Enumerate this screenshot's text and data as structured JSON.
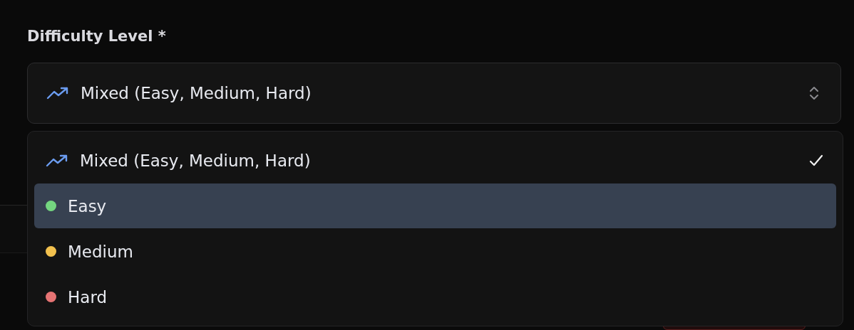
{
  "field": {
    "label": "Difficulty Level *",
    "value": "Mixed (Easy, Medium, Hard)"
  },
  "options": [
    {
      "label": "Mixed (Easy, Medium, Hard)",
      "kind": "trend",
      "selected": true,
      "highlighted": false
    },
    {
      "label": "Easy",
      "kind": "dot",
      "color": "#74d680",
      "selected": false,
      "highlighted": true
    },
    {
      "label": "Medium",
      "kind": "dot",
      "color": "#f2c14e",
      "selected": false,
      "highlighted": false
    },
    {
      "label": "Hard",
      "kind": "dot",
      "color": "#e57373",
      "selected": false,
      "highlighted": false
    }
  ]
}
